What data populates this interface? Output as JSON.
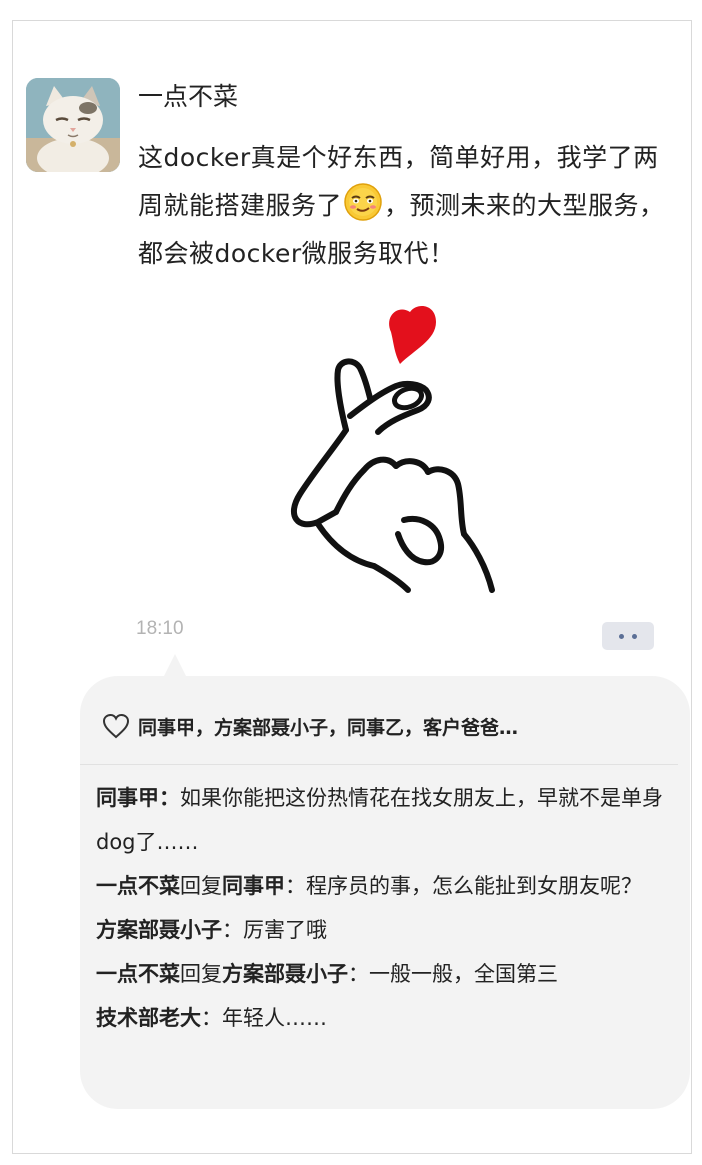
{
  "post": {
    "username": "一点不菜",
    "text_before_emoji": "这docker真是个好东西，简单好用，我学了两周就能搭建服务了",
    "emoji": "smirk-emoji",
    "text_after_emoji": "，预测未来的大型服务，都会被docker微服务取代！",
    "image": "finger-heart-hand-illustration",
    "timestamp": "18:10"
  },
  "likes": {
    "icon": "heart-outline-icon",
    "names": "同事甲，方案部聂小子，同事乙，客户爸爸…"
  },
  "comments": [
    {
      "name": "同事甲",
      "reply_label": "",
      "reply_to": "",
      "sep": "：",
      "text": "如果你能把这份热情花在找女朋友上，早就不是单身dog了……"
    },
    {
      "name": "一点不菜",
      "reply_label": "回复",
      "reply_to": "同事甲",
      "sep": "：",
      "text": "程序员的事，怎么能扯到女朋友呢？"
    },
    {
      "name": "方案部聂小子",
      "reply_label": "",
      "reply_to": "",
      "sep": "：",
      "text": "厉害了哦"
    },
    {
      "name": "一点不菜",
      "reply_label": "回复",
      "reply_to": "方案部聂小子",
      "sep": "：",
      "text": "一般一般，全国第三"
    },
    {
      "name": "技术部老大",
      "reply_label": "",
      "reply_to": "",
      "sep": "：",
      "text": "年轻人……"
    }
  ],
  "colors": {
    "heart_red": "#e3101c",
    "comment_bg": "#f3f3f3",
    "timestamp": "#b3b3b3",
    "more_dots": "#5b6f96"
  }
}
